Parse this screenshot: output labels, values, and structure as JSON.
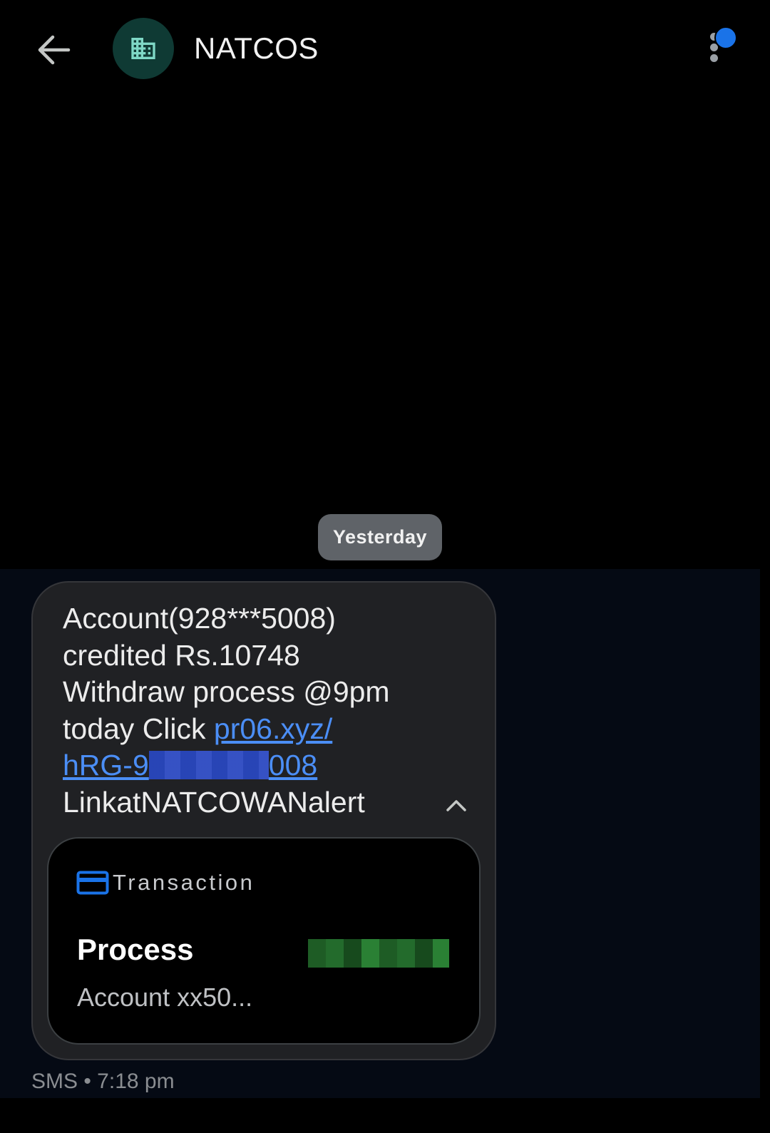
{
  "header": {
    "title": "NATCOS",
    "back_icon": "arrow-left-icon",
    "avatar_icon": "building-icon",
    "menu_icon": "more-vert-icon",
    "badge_color": "#1a73e8"
  },
  "date_chip": "Yesterday",
  "message": {
    "line1": "Account(928***5008)",
    "line2": "credited Rs.10748",
    "line3": "Withdraw process @9pm",
    "line4_text": "today Click ",
    "link_part1": "pr06.xyz/",
    "link_part2_start": "hRG-9",
    "link_part2_end": "008",
    "line6": "LinkatNATCOWANalert",
    "collapse_icon": "chevron-up-icon",
    "link_color": "#4b8ef6"
  },
  "card": {
    "label": "Transaction",
    "icon": "credit-card-icon",
    "title": "Process",
    "subtitle": "Account xx50..."
  },
  "meta": "SMS • 7:18 pm"
}
